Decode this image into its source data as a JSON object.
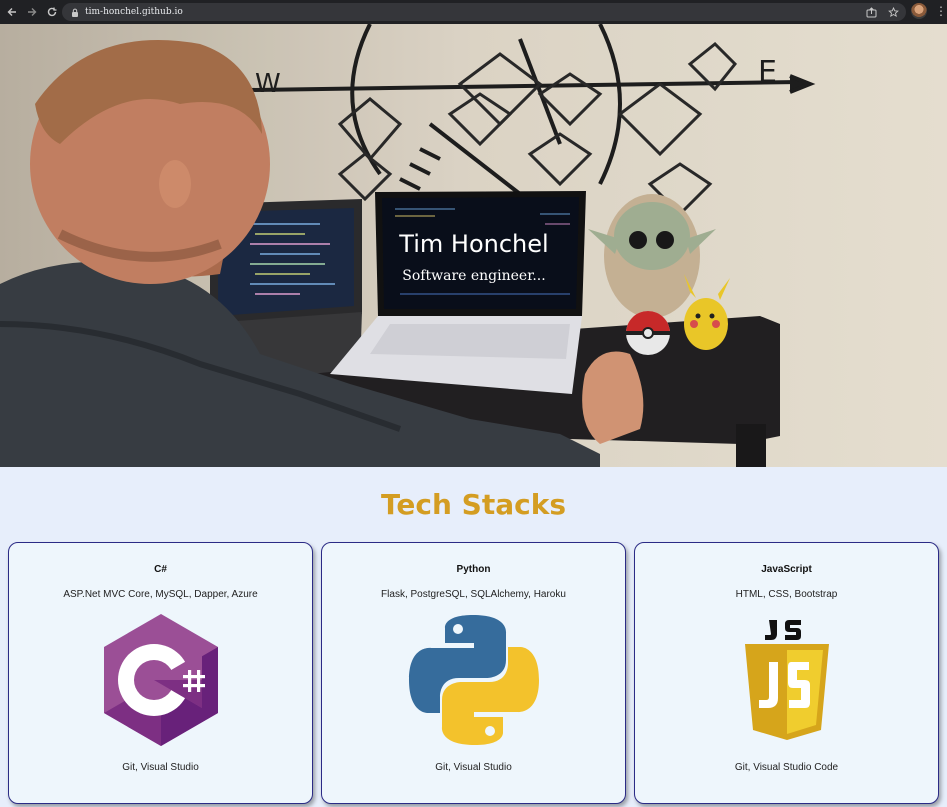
{
  "browser": {
    "url": "tim-honchel.github.io",
    "icons": [
      "back-arrow-icon",
      "forward-arrow-icon",
      "reload-icon",
      "lock-icon",
      "share-icon",
      "star-icon",
      "profile-avatar",
      "kebab-menu-icon"
    ]
  },
  "hero": {
    "title": "Tim Honchel",
    "subtitle": "Software engineer..."
  },
  "tech_stacks": {
    "heading": "Tech Stacks",
    "cards": [
      {
        "title": "C#",
        "frameworks": "ASP.Net MVC Core, MySQL, Dapper, Azure",
        "logo": "csharp-logo",
        "tools": "Git, Visual Studio"
      },
      {
        "title": "Python",
        "frameworks": "Flask, PostgreSQL, SQLAlchemy, Haroku",
        "logo": "python-logo",
        "tools": "Git, Visual Studio"
      },
      {
        "title": "JavaScript",
        "frameworks": "HTML, CSS, Bootstrap",
        "logo": "javascript-logo",
        "tools": "Git, Visual Studio Code"
      }
    ]
  },
  "colors": {
    "page_background": "#e7eefb",
    "heading": "#d49d22",
    "card_background": "#eef6fc",
    "card_border": "#2b2b86",
    "chrome": "#202124"
  }
}
